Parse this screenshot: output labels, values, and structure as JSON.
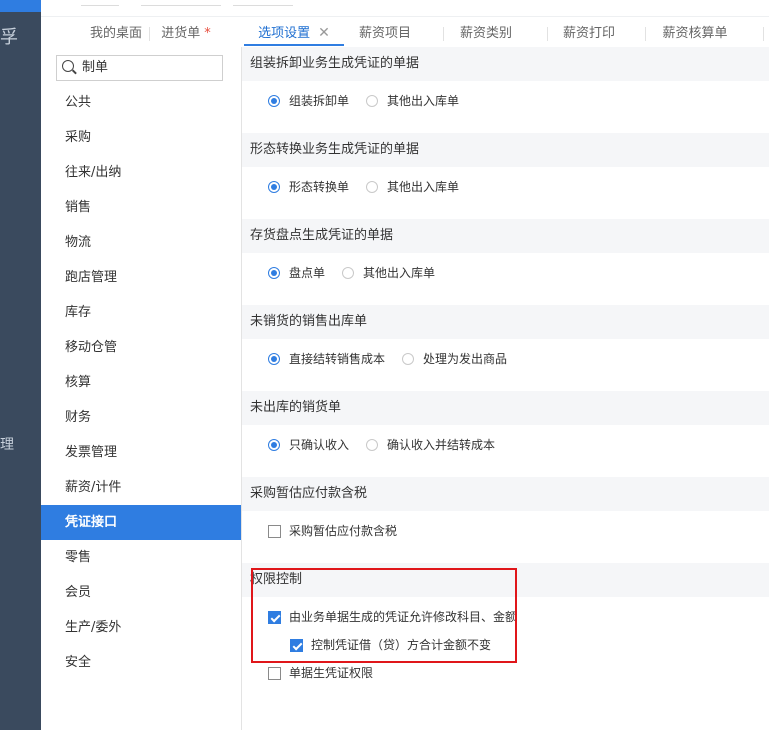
{
  "window": {
    "left_icons": [
      "app-icon",
      "manage-icon"
    ]
  },
  "tabs": [
    {
      "label": "我的桌面"
    },
    {
      "label": "进货单",
      "modified_marker": "*"
    },
    {
      "label": "选项设置",
      "close": "✕"
    },
    {
      "label": "薪资项目"
    },
    {
      "label": "薪资类别"
    },
    {
      "label": "薪资打印"
    },
    {
      "label": "薪资核算单"
    }
  ],
  "search": {
    "value": "制单"
  },
  "sidebar": {
    "items": [
      "公共",
      "采购",
      "往来/出纳",
      "销售",
      "物流",
      "跑店管理",
      "库存",
      "移动仓管",
      "核算",
      "财务",
      "发票管理",
      "薪资/计件",
      "凭证接口",
      "零售",
      "会员",
      "生产/委外",
      "安全"
    ],
    "active": "凭证接口"
  },
  "sections": [
    {
      "title": "组装拆卸业务生成凭证的单据",
      "options": [
        "组装拆卸单",
        "其他出入库单"
      ],
      "selected": 0
    },
    {
      "title": "形态转换业务生成凭证的单据",
      "options": [
        "形态转换单",
        "其他出入库单"
      ],
      "selected": 0
    },
    {
      "title": "存货盘点生成凭证的单据",
      "options": [
        "盘点单",
        "其他出入库单"
      ],
      "selected": 0
    },
    {
      "title": "未销货的销售出库单",
      "options": [
        "直接结转销售成本",
        "处理为发出商品"
      ],
      "selected": 0
    },
    {
      "title": "未出库的销货单",
      "options": [
        "只确认收入",
        "确认收入并结转成本"
      ],
      "selected": 0
    },
    {
      "title": "采购暂估应付款含税",
      "checkbox": {
        "label": "采购暂估应付款含税",
        "checked": false
      }
    },
    {
      "title": "权限控制",
      "checkboxes": [
        {
          "label": "由业务单据生成的凭证允许修改科目、金额",
          "checked": true
        },
        {
          "label": "控制凭证借（贷）方合计金额不变",
          "checked": true
        },
        {
          "label": "单据生凭证权限",
          "checked": false
        }
      ]
    }
  ],
  "colors": {
    "accent": "#2f7de1",
    "sidebar_dark": "#3a4a5e",
    "highlight_box": "#e0161a"
  }
}
